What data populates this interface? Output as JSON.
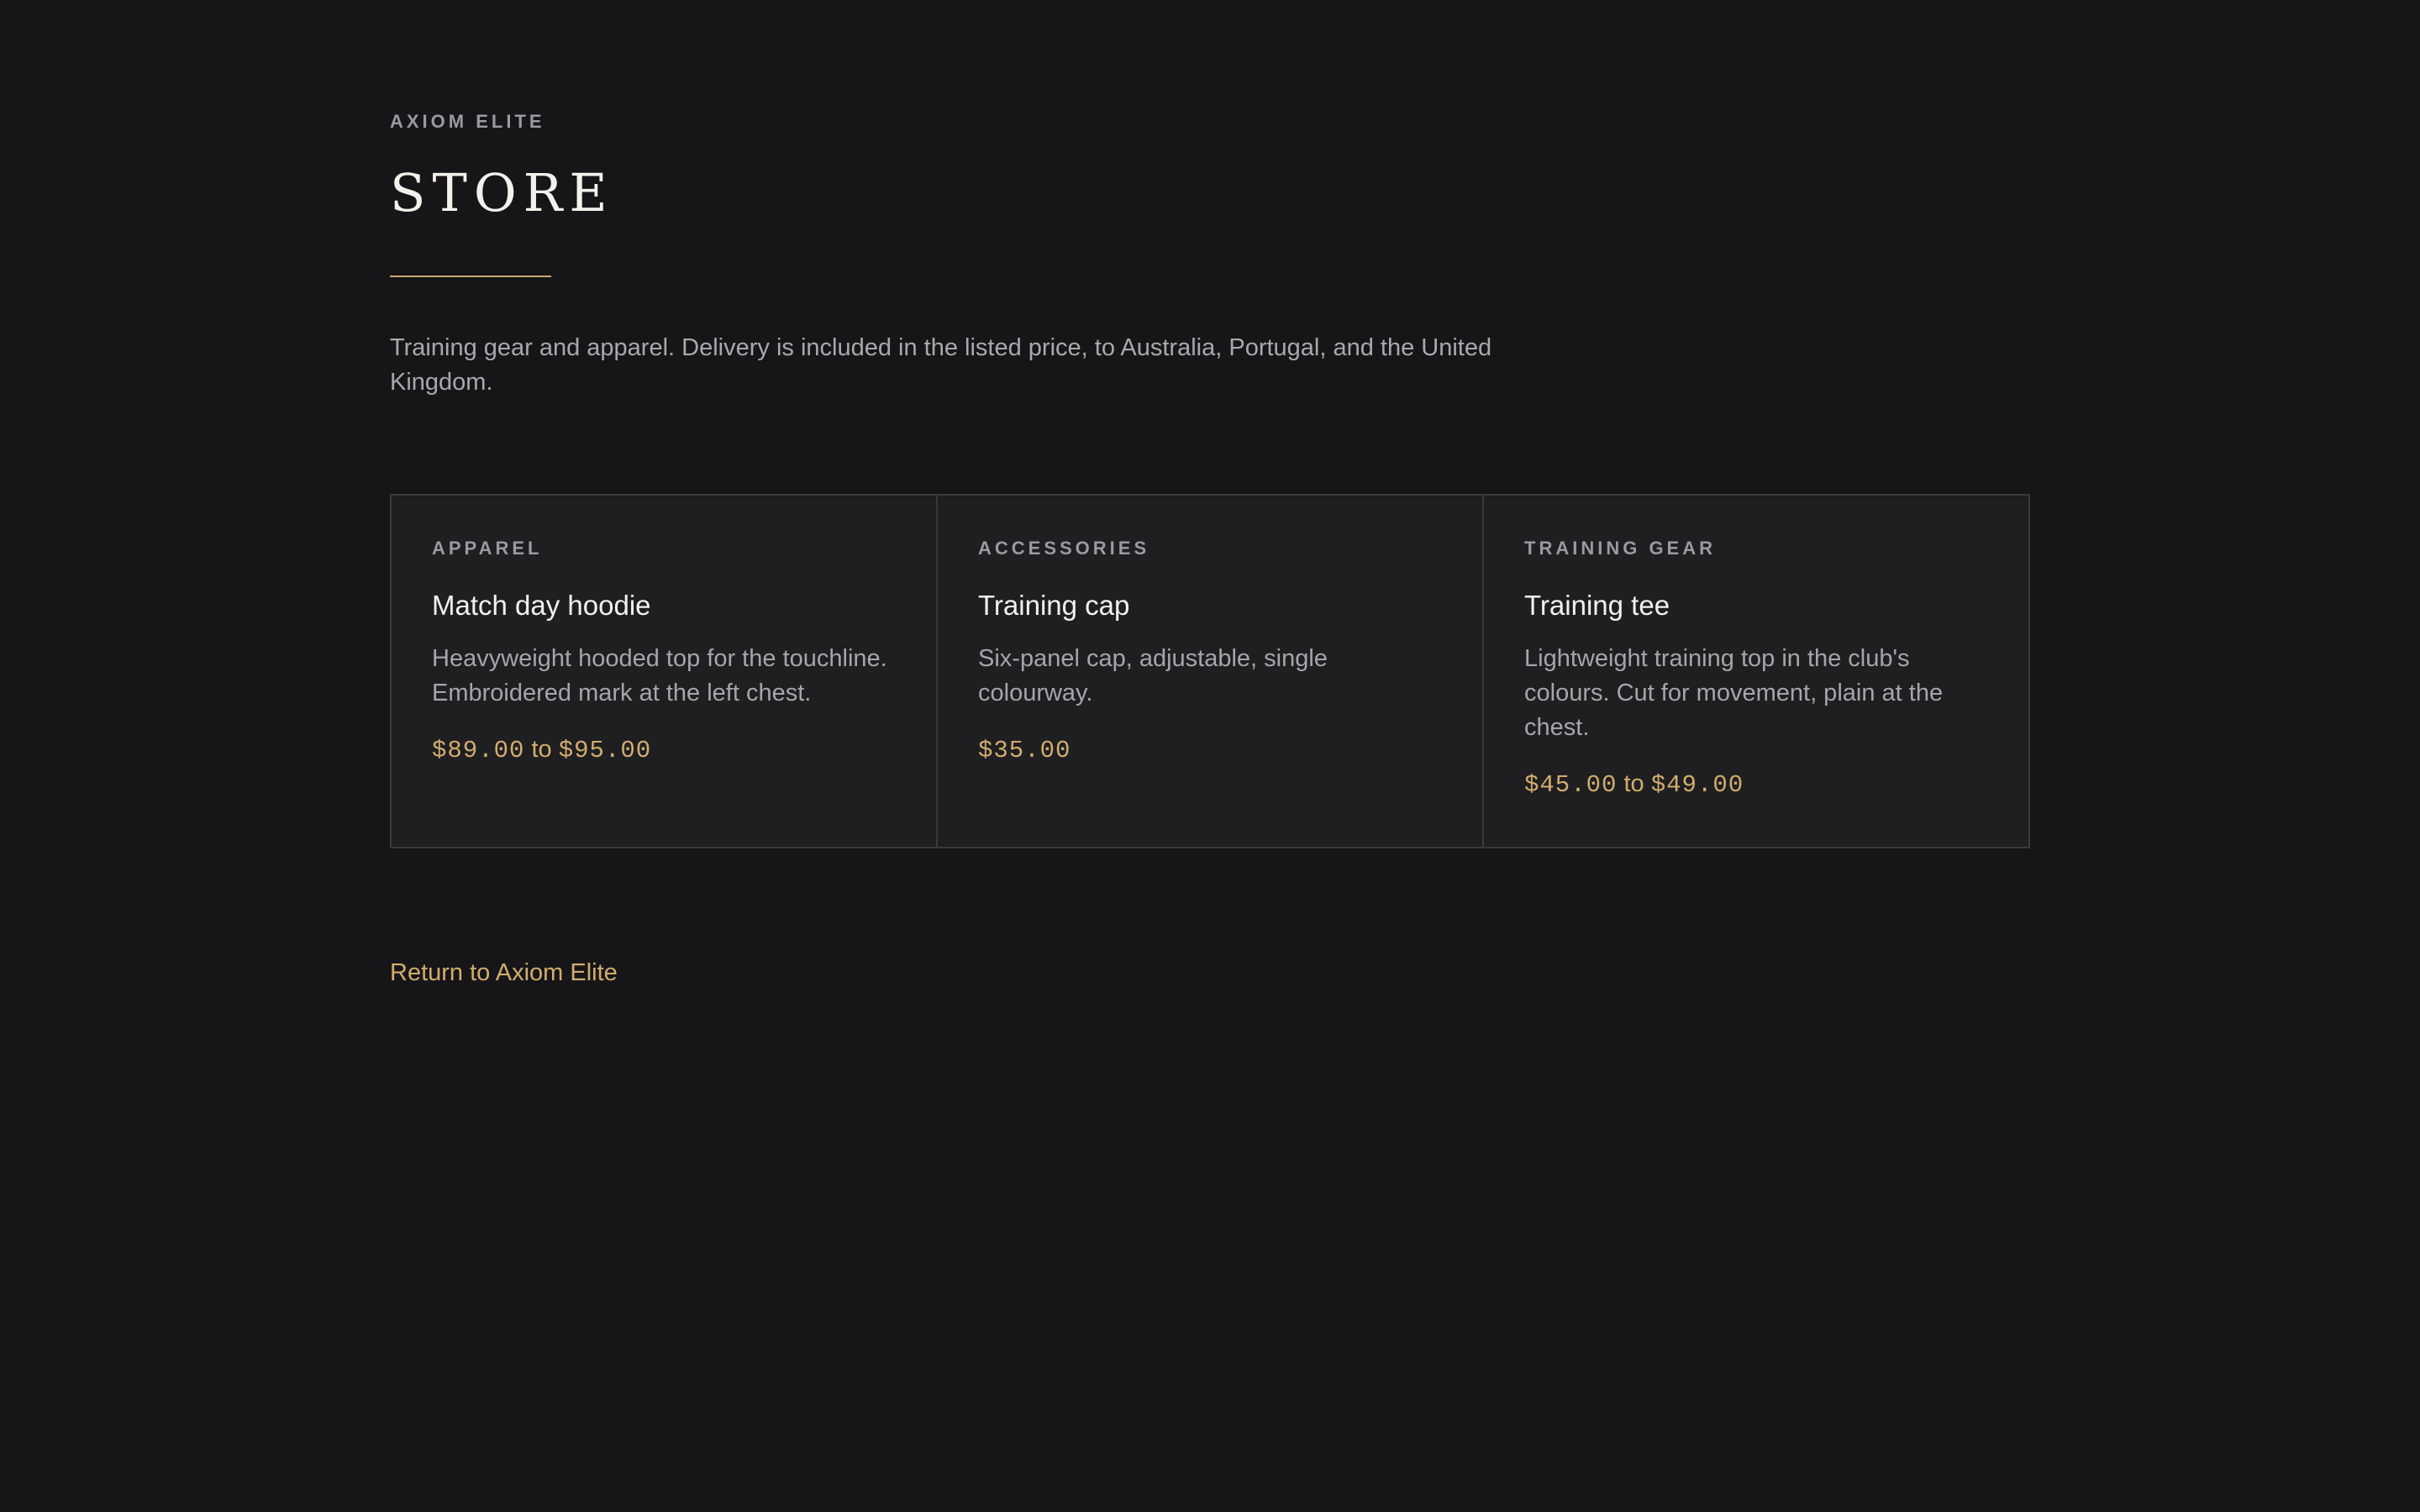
{
  "header": {
    "brand": "AXIOM ELITE",
    "title": "STORE",
    "intro": "Training gear and apparel. Delivery is included in the listed price, to Australia, Portugal, and the United Kingdom."
  },
  "products": [
    {
      "category": "APPAREL",
      "name": "Match day hoodie",
      "description": "Heavyweight hooded top for the touchline. Embroidered mark at the left chest.",
      "price_low": "$89.00",
      "price_sep": " to ",
      "price_high": "$95.00"
    },
    {
      "category": "ACCESSORIES",
      "name": "Training cap",
      "description": "Six-panel cap, adjustable, single colourway.",
      "price_low": "$35.00"
    },
    {
      "category": "TRAINING GEAR",
      "name": "Training tee",
      "description": "Lightweight training top in the club's colours. Cut for movement, plain at the chest.",
      "price_low": "$45.00",
      "price_sep": " to ",
      "price_high": "$49.00"
    }
  ],
  "footer": {
    "return_link": "Return to Axiom Elite"
  },
  "colors": {
    "background": "#161618",
    "card_background": "#1f1f21",
    "accent_gold": "#d1ad6d",
    "heading": "#f4f1ec",
    "body_text": "#a6a6aa",
    "border": "#3a3a3d"
  }
}
